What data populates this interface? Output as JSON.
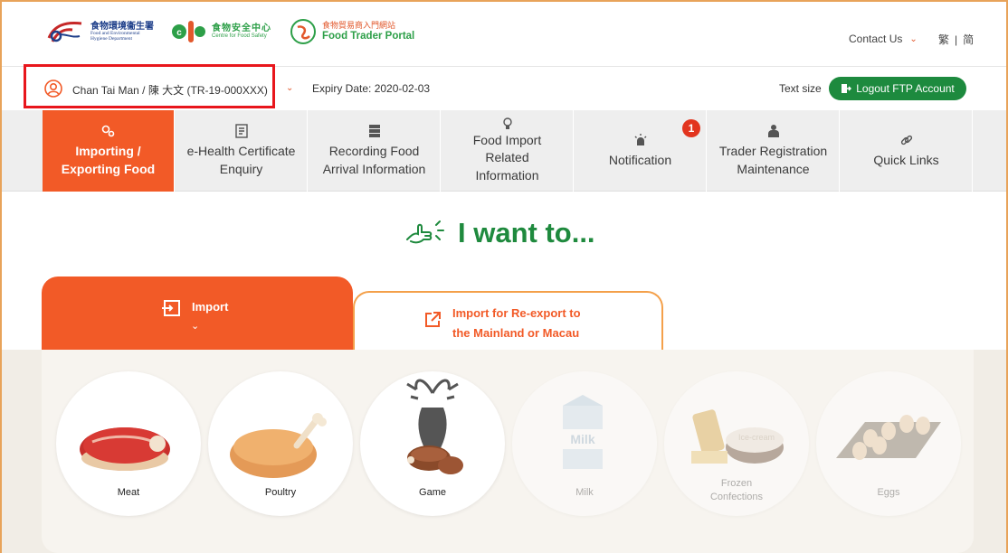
{
  "colors": {
    "brand_orange": "#f25a27",
    "brand_green": "#1d8a3e",
    "highlight_red": "#e8161c",
    "nav_bg": "#eeeeee",
    "panel_bg": "#f7f4ef"
  },
  "header": {
    "logos": {
      "fehd": {
        "zh": "食物環境衞生署",
        "en1": "Food and Environmental",
        "en2": "Hygiene Department",
        "icon": "fehd-logo"
      },
      "cfs": {
        "zh": "食物安全中心",
        "en": "Centre for Food Safety",
        "icon": "cfs-logo"
      },
      "ftp": {
        "zh": "食物貿易商入門網站",
        "en": "Food Trader Portal",
        "icon": "ftp-logo"
      }
    },
    "contact_label": "Contact Us",
    "contact_icon": "chevron-down-icon",
    "lang_tc": "繁",
    "lang_sep": "|",
    "lang_sc": "简"
  },
  "userbar": {
    "user_icon": "user-circle-icon",
    "user_name": "Chan Tai Man / 陳 大文 (TR-19-000XXX)",
    "user_chevron_icon": "chevron-down-icon",
    "expiry": "Expiry Date: 2020-02-03",
    "text_size_label": "Text size",
    "logout_icon": "logout-icon",
    "logout_label": "Logout FTP Account"
  },
  "nav": {
    "items": [
      {
        "label": "Importing / Exporting Food",
        "icon": "import-export-icon",
        "active": true
      },
      {
        "label": "e-Health Certificate Enquiry",
        "icon": "certificate-icon"
      },
      {
        "label": "Recording Food Arrival Information",
        "icon": "record-icon"
      },
      {
        "label": "Food Import Related Information",
        "icon": "lightbulb-icon"
      },
      {
        "label": "Notification",
        "icon": "siren-icon",
        "badge": "1"
      },
      {
        "label": "Trader Registration Maintenance",
        "icon": "person-icon"
      },
      {
        "label": "Quick Links",
        "icon": "link-icon"
      }
    ]
  },
  "main": {
    "heading": "I want to...",
    "heading_icon": "pointing-hand-icon",
    "tabs": [
      {
        "label": "Import",
        "icon": "import-icon",
        "chevron_icon": "chevron-down-icon",
        "active": true
      },
      {
        "label_line1": "Import for Re-export to",
        "label_line2": "the Mainland or Macau",
        "icon": "external-link-icon"
      }
    ],
    "foods": [
      {
        "label": "Meat",
        "icon": "meat-icon",
        "enabled": true
      },
      {
        "label": "Poultry",
        "icon": "poultry-icon",
        "enabled": true
      },
      {
        "label": "Game",
        "icon": "game-icon",
        "enabled": true
      },
      {
        "label": "Milk",
        "icon": "milk-icon",
        "carton_text": "Milk",
        "enabled": false
      },
      {
        "label_line1": "Frozen",
        "label_line2": "Confections",
        "icon": "ice-cream-icon",
        "tub_text": "Ice-cream",
        "enabled": false
      },
      {
        "label": "Eggs",
        "icon": "eggs-icon",
        "enabled": false
      }
    ]
  }
}
